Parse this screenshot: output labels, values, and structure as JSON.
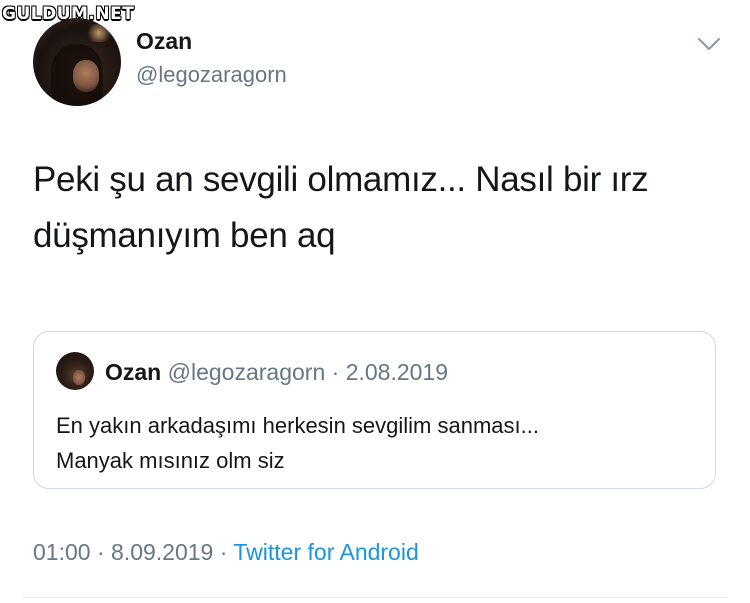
{
  "watermark": "GULDUM.NET",
  "tweet": {
    "author_name": "Ozan",
    "author_handle": "@legozaragorn",
    "text_lines": [
      "Peki şu an sevgili olmamız... Nasıl bir ırz",
      "düşmanıyım ben aq"
    ],
    "time": "01:00",
    "date": "8.09.2019",
    "separator": "·",
    "source": "Twitter for Android"
  },
  "quoted_tweet": {
    "author_name": "Ozan",
    "author_handle": "@legozaragorn",
    "separator": "·",
    "date": "2.08.2019",
    "text_lines": [
      "En yakın arkadaşımı herkesin sevgilim sanması...",
      "Manyak mısınız olm siz"
    ]
  },
  "icons": {
    "menu": "chevron-down-icon",
    "avatar": "profile-avatar"
  },
  "colors": {
    "text_primary": "#14171a",
    "text_secondary": "#657786",
    "link": "#1b95e0",
    "border": "#cfd9de"
  }
}
